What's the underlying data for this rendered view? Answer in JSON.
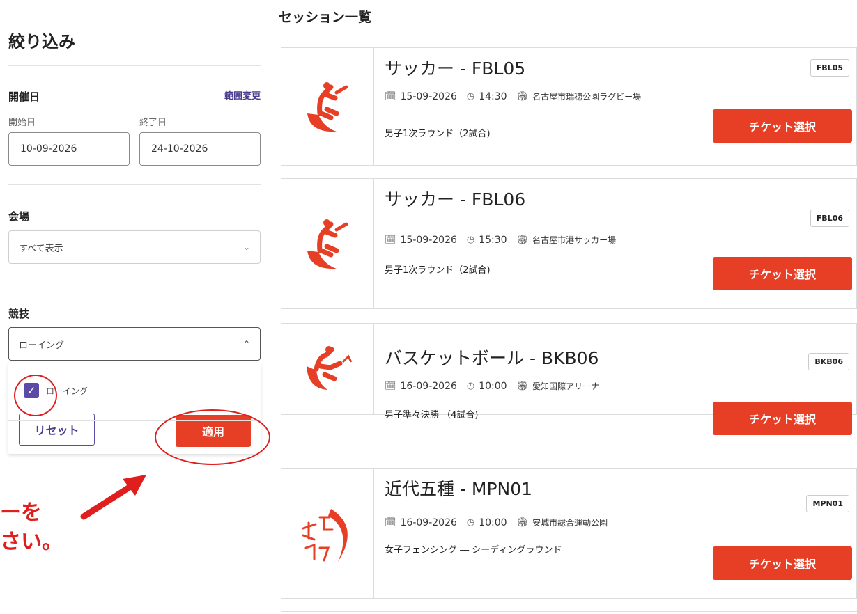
{
  "filter": {
    "title": "絞り込み",
    "date_label": "開催日",
    "range_change": "範囲変更",
    "start_label": "開始日",
    "end_label": "終了日",
    "start_value": "10-09-2026",
    "end_value": "24-10-2026",
    "venue_label": "会場",
    "venue_value": "すべて表示",
    "sport_label": "競技",
    "sport_value": "ローイング",
    "sport_option": "ローイング",
    "reset": "リセット",
    "apply": "適用"
  },
  "annotation": {
    "line1": "ーを",
    "line2": "さい。",
    "color": "#e01e1e"
  },
  "list": {
    "title": "セッション一覧",
    "sessions": [
      {
        "name": "サッカー - FBL05",
        "code": "FBL05",
        "date": "15-09-2026",
        "time": "14:30",
        "venue": "名古屋市瑞穂公園ラグビー場",
        "desc": "男子1次ラウンド（2試合)",
        "button": "チケット選択",
        "icon": "soccer-pictogram-icon"
      },
      {
        "name": "サッカー - FBL06",
        "code": "FBL06",
        "date": "15-09-2026",
        "time": "15:30",
        "venue": "名古屋市港サッカー場",
        "desc": "男子1次ラウンド（2試合)",
        "button": "チケット選択",
        "icon": "soccer-pictogram-icon"
      },
      {
        "name": "バスケットボール - BKB06",
        "code": "BKB06",
        "date": "16-09-2026",
        "time": "10:00",
        "venue": "愛知国際アリーナ",
        "desc": "男子準々決勝 （4試合)",
        "button": "チケット選択",
        "icon": "basketball-pictogram-icon"
      },
      {
        "name": "近代五種 - MPN01",
        "code": "MPN01",
        "date": "16-09-2026",
        "time": "10:00",
        "venue": "安城市総合運動公園",
        "desc": "女子フェンシング ― シーディングラウンド",
        "button": "チケット選択",
        "icon": "modern-pentathlon-pictogram-icon"
      }
    ]
  },
  "colors": {
    "accent": "#e63f26",
    "brand_purple": "#5b4aa6"
  }
}
